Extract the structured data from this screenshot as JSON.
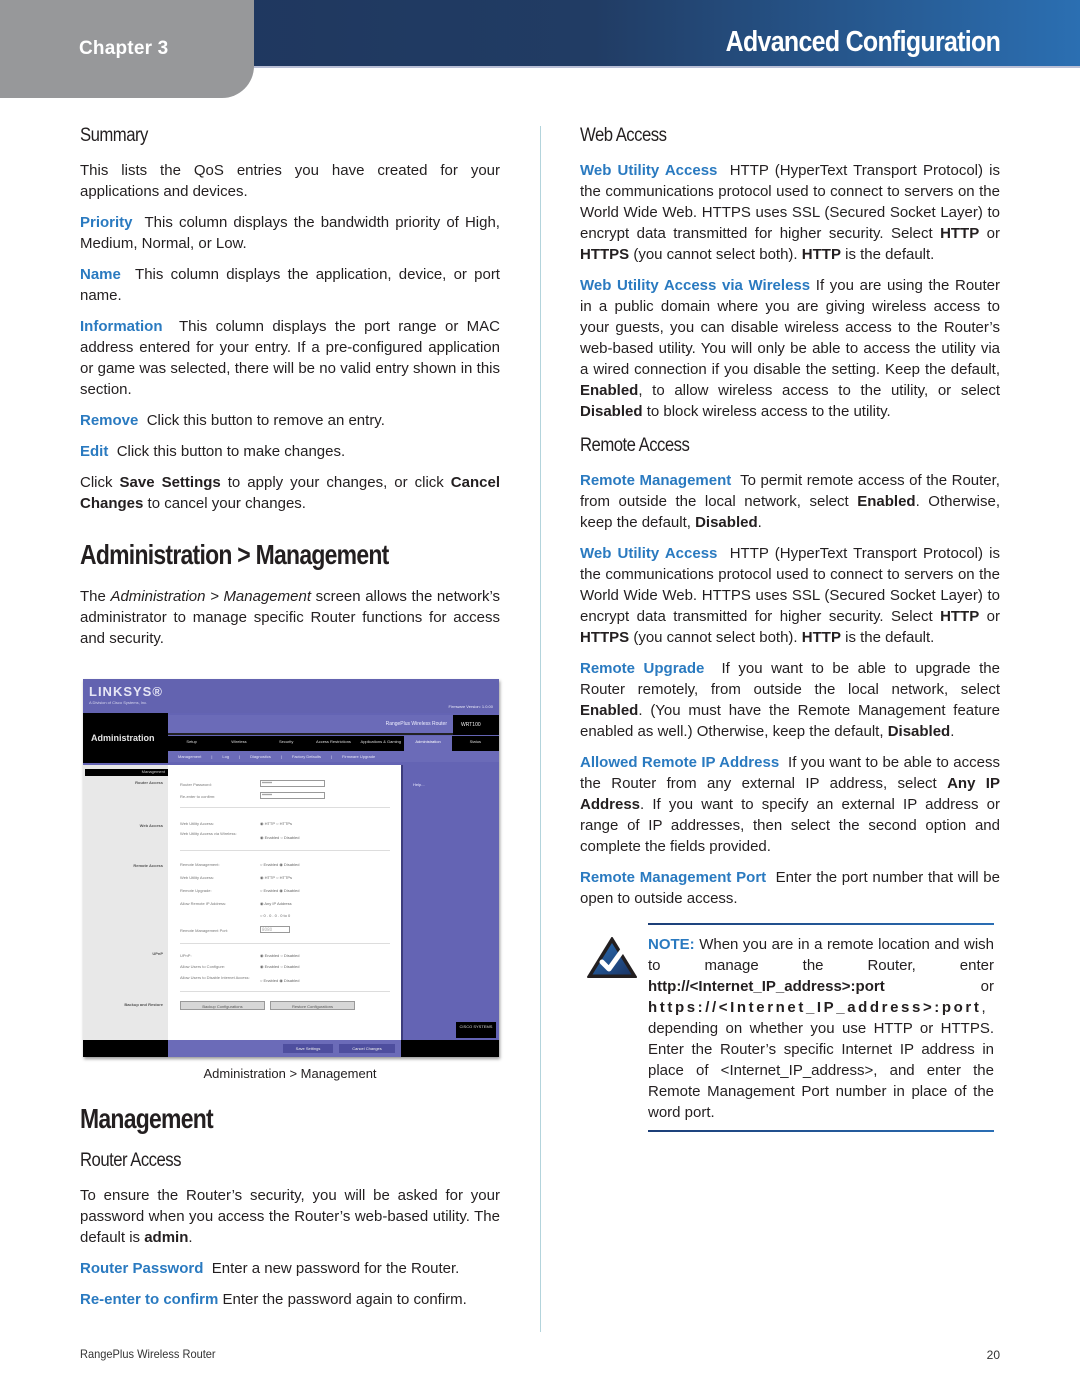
{
  "header": {
    "chapter": "Chapter 3",
    "title": "Advanced Configuration",
    "accent_color": "#1e355c",
    "term_color": "#2a7ac0"
  },
  "left": {
    "summary": {
      "heading": "Summary",
      "intro": "This lists the QoS entries you have created for your applications and devices.",
      "items": [
        {
          "term": "Priority",
          "text": "This column displays the bandwidth priority of High, Medium, Normal, or Low."
        },
        {
          "term": "Name",
          "text": "This column displays the application, device, or port name."
        },
        {
          "term": "Information",
          "text": "This column displays the port range or MAC address entered for your entry. If a pre-configured application or game was selected, there will be no valid entry shown in this section."
        },
        {
          "term": "Remove",
          "text": "Click this button to remove an entry."
        },
        {
          "term": "Edit",
          "text": "Click this button to make changes."
        }
      ],
      "closing": {
        "pre": "Click ",
        "b1": "Save Settings",
        "mid": " to apply your changes, or click ",
        "b2": "Cancel Changes",
        "post": " to cancel your changes."
      }
    },
    "admin_section": {
      "heading": "Administration > Management",
      "intro_pre": "The ",
      "intro_italic": "Administration > Management",
      "intro_post": " screen allows the network’s administrator to manage specific Router functions for access and security."
    },
    "screenshot": {
      "logo": "LINKSYS®",
      "logo_sub": "A Division of Cisco Systems, Inc.",
      "firmware": "Firmware Version: 1.0.00",
      "section": "Administration",
      "product": "RangePlus Wireless Router",
      "model": "WRT100",
      "tabs": [
        "Setup",
        "Wireless",
        "Security",
        "Access Restrictions",
        "Applications & Gaming",
        "Administration",
        "Status"
      ],
      "active_tab": "Administration",
      "subtabs": [
        "Management",
        "|",
        "Log",
        "|",
        "Diagnostics",
        "|",
        "Factory Defaults",
        "|",
        "Firmware Upgrade"
      ],
      "left_head": "Management",
      "left_items": [
        "Router Access",
        "Web Access",
        "Remote Access",
        "UPnP",
        "Backup and Restore"
      ],
      "rows": [
        {
          "label": "Router Password:",
          "value": "*****"
        },
        {
          "label": "Re-enter to confirm:",
          "value": "*****"
        },
        {
          "label": "Web Utility Access:",
          "value": "◉ HTTP  ○ HTTPs"
        },
        {
          "label": "Web Utility Access via Wireless:",
          "value": "◉ Enabled  ○ Disabled"
        },
        {
          "label": "Remote Management:",
          "value": "○ Enabled  ◉ Disabled"
        },
        {
          "label": "Web Utility Access:",
          "value": "◉ HTTP  ○ HTTPs"
        },
        {
          "label": "Remote Upgrade:",
          "value": "○ Enabled  ◉ Disabled"
        },
        {
          "label": "Allow Remote IP Address:",
          "value": "◉ Any IP Address"
        },
        {
          "label": "",
          "value": "○ 0 . 0 . 0 . 0 to 0"
        },
        {
          "label": "Remote Management Port:",
          "value": "8080"
        },
        {
          "label": "UPnP:",
          "value": "◉ Enabled  ○ Disabled"
        },
        {
          "label": "Allow Users to Configure:",
          "value": "◉ Enabled  ○ Disabled"
        },
        {
          "label": "Allow Users to Disable Internet Access:",
          "value": "○ Enabled  ◉ Disabled"
        }
      ],
      "backup_button": "Backup Configurations",
      "restore_button": "Restore Configurations",
      "help_link": "Help...",
      "cisco": "CISCO SYSTEMS",
      "save_button": "Save Settings",
      "cancel_button": "Cancel Changes"
    },
    "caption": "Administration > Management",
    "management": {
      "heading": "Management",
      "router_access_heading": "Router Access",
      "router_access_intro_pre": "To ensure the Router’s security, you will be asked for your password when you access the Router’s web-based utility. The default is ",
      "router_access_intro_bold": "admin",
      "router_access_intro_post": ".",
      "items": [
        {
          "term": "Router Password",
          "text": "Enter a new password for the Router."
        },
        {
          "term": "Re-enter to confirm",
          "text": "Enter the password again to confirm."
        }
      ]
    }
  },
  "right": {
    "web_access": {
      "heading": "Web Access",
      "wua_term": "Web Utility Access",
      "wua_text_1": "HTTP (HyperText Transport Protocol) is the communications protocol used to connect to servers on the World Wide Web. HTTPS uses SSL (Secured Socket Layer) to encrypt data transmitted for higher security. Select ",
      "b_http": "HTTP",
      "or": " or ",
      "b_https": "HTTPS",
      "wua_text_2": " (you cannot select both). ",
      "wua_text_3": " is the default.",
      "wireless_term": "Web Utility Access via Wireless",
      "wireless_text_1": "If you are using the Router in a public domain where you are giving wireless access to your guests, you can disable wireless access to the Router’s web-based utility. You will only be able to access the utility via a wired connection if you disable the setting. Keep the default, ",
      "b_enabled": "Enabled",
      "wireless_text_2": ", to allow wireless access to the utility, or select ",
      "b_disabled": "Disabled",
      "wireless_text_3": " to block wireless access to the utility."
    },
    "remote_access": {
      "heading": "Remote Access",
      "rm_term": "Remote Management",
      "rm_text_1": "To permit remote access of the Router, from outside the local network, select ",
      "rm_b1": "Enabled",
      "rm_text_2": ". Otherwise, keep the default, ",
      "rm_b2": "Disabled",
      "rm_text_3": ".",
      "wua_term": "Web Utility Access",
      "wua_text_1": "HTTP (HyperText Transport Protocol) is the communications protocol used to connect to servers on the World Wide Web. HTTPS uses SSL (Secured Socket Layer) to encrypt data transmitted for higher security. Select ",
      "b_http": "HTTP",
      "or": " or ",
      "b_https": "HTTPS",
      "wua_text_2": " (you cannot select both). ",
      "wua_text_3": " is the default.",
      "ru_term": "Remote Upgrade",
      "ru_text_1": "If you want to be able to upgrade the Router remotely, from outside the local network, select ",
      "ru_b1": "Enabled",
      "ru_text_2": ". (You must have the Remote Management feature enabled as well.) Otherwise, keep the default, ",
      "ru_b2": "Disabled",
      "ru_text_3": ".",
      "ip_term": "Allowed Remote IP Address",
      "ip_text_1": "If you want to be able to access the Router from any external IP address, select ",
      "ip_b1": "Any IP Address",
      "ip_text_2": ". If you want to specify an external IP address or range of IP addresses, then select the second option and complete the fields provided.",
      "port_term": "Remote Management Port",
      "port_text": "Enter the port number that will be open to outside access."
    },
    "note": {
      "label": "NOTE:",
      "text_1": " When you are in a remote location and wish to manage the Router, enter ",
      "url_http": "http://<Internet_IP_address>:port",
      "or": " or ",
      "url_https": "https://<Internet_IP_address>:port",
      "text_2": ", depending on whether you use HTTP or HTTPS. Enter the Router’s specific Internet IP address in place of <Internet_IP_address>, and enter the Remote Management Port number in place of the word port."
    }
  },
  "footer": {
    "product": "RangePlus Wireless Router",
    "page": "20"
  }
}
